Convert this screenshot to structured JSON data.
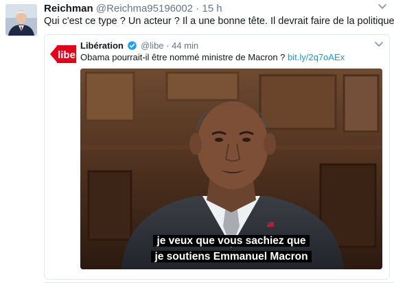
{
  "tweet": {
    "author_name": "Reichman",
    "author_handle": "@Reichma95196002",
    "separator": "·",
    "time": "15 h",
    "text": "Qui c'est ce type ? Un acteur ? Il a une bonne têtе. Il devrait faire de la politique."
  },
  "quoted": {
    "logo_text": "libe",
    "author_name": "Libération",
    "author_handle": "@libe",
    "separator": "·",
    "time": "44 min",
    "text": "Obama pourrait-il être nommé ministre de Macron ?",
    "link": "bit.ly/2q7oAEx",
    "media": {
      "subtitle_line1": "je veux que vous sachiez que",
      "subtitle_line2": "je soutiens Emmanuel Macron"
    }
  },
  "icons": {
    "caret": "chevron-down-icon",
    "verified": "verified-badge-icon",
    "avatar": "user-avatar"
  },
  "colors": {
    "link": "#1b95e0",
    "verified": "#1da1f2",
    "muted": "#657786",
    "brand_red": "#e3001b"
  }
}
